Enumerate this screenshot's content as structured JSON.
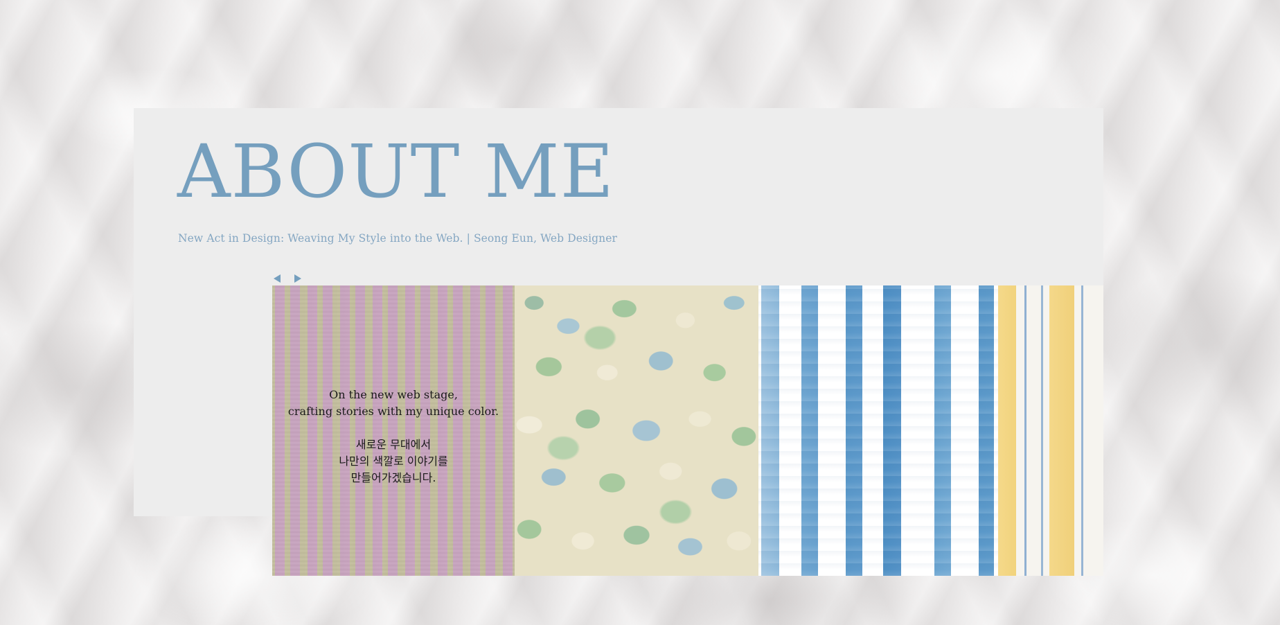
{
  "header": {
    "title": "ABOUT ME",
    "subtitle": "New Act in Design: Weaving My Style into the Web. | Seong Eun, Web Designer"
  },
  "slider": {
    "prev_icon": "triangle-left-icon",
    "next_icon": "triangle-right-icon",
    "accent_color": "#759fbe"
  },
  "gallery": {
    "intro_en_line1": "On the new web stage,",
    "intro_en_line2": "crafting stories with my unique color.",
    "intro_ko_line1": "새로운 무대에서",
    "intro_ko_line2": "나만의 색깔로 이야기를",
    "intro_ko_line3": "만들어가겠습니다."
  }
}
